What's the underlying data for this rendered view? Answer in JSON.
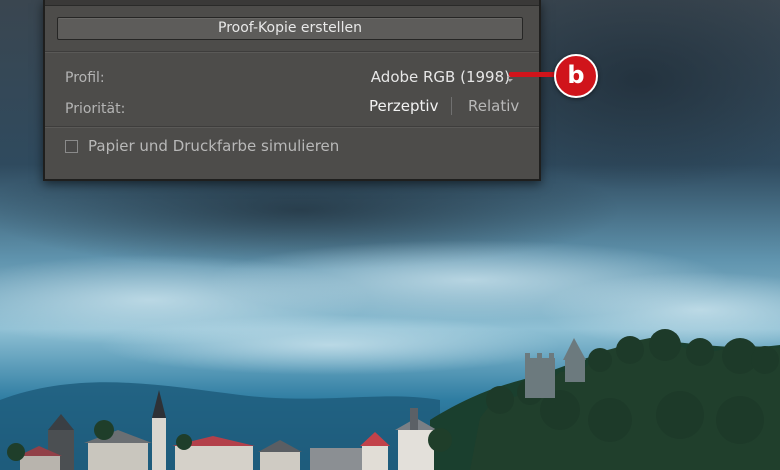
{
  "panel": {
    "proof_button_label": "Proof-Kopie erstellen",
    "profile_label": "Profil:",
    "profile_value": "Adobe RGB (1998)",
    "intent_label": "Priorität:",
    "intent_options": [
      "Perzeptiv",
      "Relativ"
    ],
    "intent_selected": "Perzeptiv",
    "simulate_label": "Papier und Druckfarbe simulieren",
    "simulate_checked": false
  },
  "callout": {
    "label": "b",
    "color": "#d0141b"
  },
  "colors": {
    "panel_bg": "#4d4c4a",
    "sky_dark": "#2b3d4c",
    "sky_light": "#7fb0c6"
  }
}
